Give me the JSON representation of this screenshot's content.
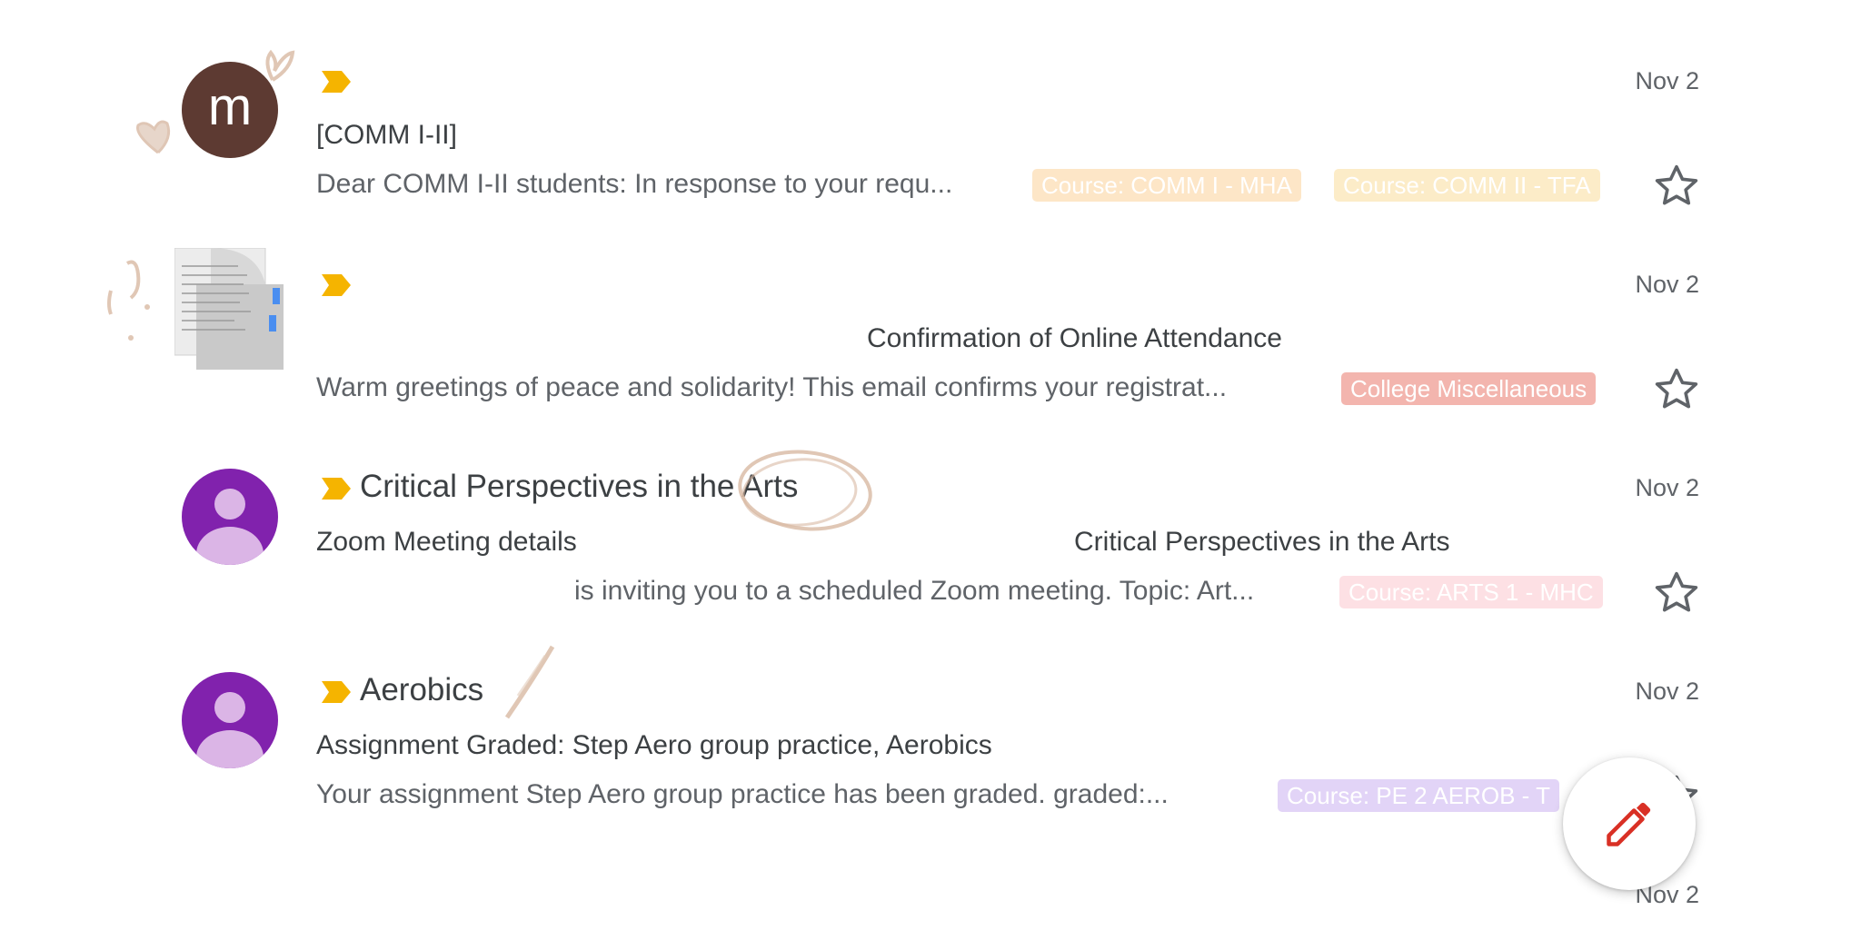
{
  "emails": [
    {
      "avatar_letter": "m",
      "sender": "",
      "date": "Nov 2",
      "subject": "[COMM I-II]",
      "snippet": "Dear COMM I-II students: In response to your requ...",
      "labels": [
        "Course: COMM I - MHA",
        "Course: COMM II - TFA"
      ],
      "label_colors": [
        "#fde6c7",
        "#fcecc8"
      ]
    },
    {
      "avatar_letter": "",
      "sender": "",
      "date": "Nov 2",
      "subject": "Confirmation of Online Attendance",
      "snippet": "Warm greetings of peace and solidarity! This email confirms your registrat...",
      "labels": [
        "College Miscellaneous"
      ],
      "label_colors": [
        "#f3b5ae"
      ]
    },
    {
      "avatar_letter": "",
      "sender": "Critical Perspectives in the Arts",
      "date": "Nov 2",
      "subject_a": "Zoom Meeting details",
      "subject_b": "Critical Perspectives in the Arts",
      "snippet": "is inviting you to a scheduled Zoom meeting. Topic: Art...",
      "labels": [
        "Course: ARTS 1 - MHC"
      ],
      "label_colors": [
        "#fde0e4"
      ]
    },
    {
      "avatar_letter": "",
      "sender": "Aerobics",
      "date": "Nov 2",
      "subject": "Assignment Graded: Step Aero group practice, Aerobics",
      "snippet": "Your assignment Step Aero group practice has been graded. graded:...",
      "labels": [
        "Course: PE 2 AEROB - T"
      ],
      "label_colors": [
        "#e2d4f7"
      ]
    },
    {
      "date": "Nov 2"
    }
  ],
  "colors": {
    "importance_marker": "#f5b400",
    "compose_pencil": "#d93025"
  },
  "icons": {
    "star": "star-outline-icon",
    "importance": "importance-marker-icon",
    "compose": "pencil-icon"
  }
}
